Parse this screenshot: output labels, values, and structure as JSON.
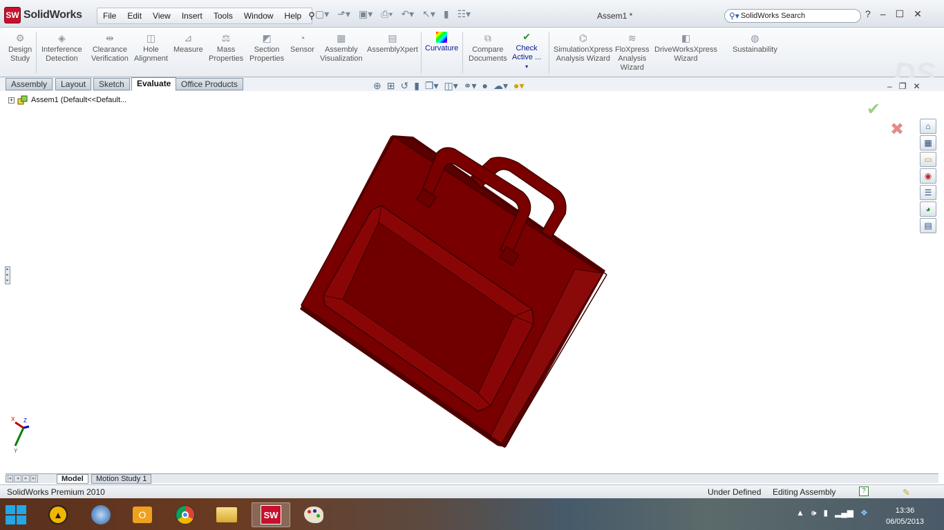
{
  "app": {
    "logo_text": "SolidWorks",
    "logo_badge": "SW",
    "doc_title": "Assem1 *"
  },
  "menu": {
    "items": [
      "File",
      "Edit",
      "View",
      "Insert",
      "Tools",
      "Window",
      "Help"
    ]
  },
  "search": {
    "placeholder": "SolidWorks Search"
  },
  "window_controls": {
    "help": "?",
    "minimize": "–",
    "maximize": "☐",
    "close": "✕"
  },
  "commands": [
    {
      "line1": "Design",
      "line2": "Study",
      "icon": "design-study-icon"
    },
    {
      "line1": "Interference",
      "line2": "Detection",
      "icon": "interference-detection-icon"
    },
    {
      "line1": "Clearance",
      "line2": "Verification",
      "icon": "clearance-verification-icon"
    },
    {
      "line1": "Hole",
      "line2": "Alignment",
      "icon": "hole-alignment-icon"
    },
    {
      "line1": "Measure",
      "line2": "",
      "icon": "measure-icon"
    },
    {
      "line1": "Mass",
      "line2": "Properties",
      "icon": "mass-properties-icon"
    },
    {
      "line1": "Section",
      "line2": "Properties",
      "icon": "section-properties-icon"
    },
    {
      "line1": "Sensor",
      "line2": "",
      "icon": "sensor-icon"
    },
    {
      "line1": "Assembly",
      "line2": "Visualization",
      "icon": "assembly-visualization-icon"
    },
    {
      "line1": "AssemblyXpert",
      "line2": "",
      "icon": "assemblyxpert-icon"
    },
    {
      "line1": "Curvature",
      "line2": "",
      "icon": "curvature-icon"
    },
    {
      "line1": "Compare",
      "line2": "Documents",
      "icon": "compare-documents-icon"
    },
    {
      "line1": "Check",
      "line2": "Active ...",
      "icon": "check-active-icon"
    },
    {
      "line1": "SimulationXpress",
      "line2": "Analysis Wizard",
      "icon": "simulationxpress-icon"
    },
    {
      "line1": "FloXpress",
      "line2": "Analysis",
      "line3": "Wizard",
      "icon": "floxpress-icon"
    },
    {
      "line1": "DriveWorksXpress",
      "line2": "Wizard",
      "icon": "driveworksxpress-icon"
    },
    {
      "line1": "Sustainability",
      "line2": "",
      "icon": "sustainability-icon"
    }
  ],
  "tabs": [
    "Assembly",
    "Layout",
    "Sketch",
    "Evaluate",
    "Office Products"
  ],
  "tree": {
    "root_label": "Assem1  (Default<<Default..."
  },
  "triad": {
    "x": "X",
    "y": "Y",
    "z": "Z"
  },
  "bottom_tabs": [
    "Model",
    "Motion Study 1"
  ],
  "status": {
    "product": "SolidWorks Premium 2010",
    "definition": "Under Defined",
    "mode": "Editing Assembly",
    "help": "?"
  },
  "clock": {
    "time": "13:36",
    "date": "06/05/2013"
  },
  "colors": {
    "model": "#7a0000",
    "model_edge": "#3d0000",
    "accent": "#0b1a8c"
  }
}
